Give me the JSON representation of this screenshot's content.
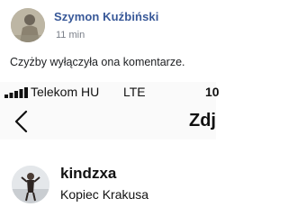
{
  "comment": {
    "author": "Szymon Kuźbiński",
    "time": "11 min",
    "text": "Czyżby wyłączyła ona komentarze."
  },
  "screenshot": {
    "status_bar": {
      "carrier": "Telekom HU",
      "network": "LTE",
      "clock": "10"
    },
    "nav": {
      "back_icon": "chevron-left-icon",
      "title": "Zdj"
    },
    "post": {
      "username": "kindzxa",
      "location": "Kopiec Krakusa"
    }
  },
  "colors": {
    "author_link": "#385898",
    "meta_gray": "#7a7f88",
    "text_dark": "#1c1e21"
  }
}
